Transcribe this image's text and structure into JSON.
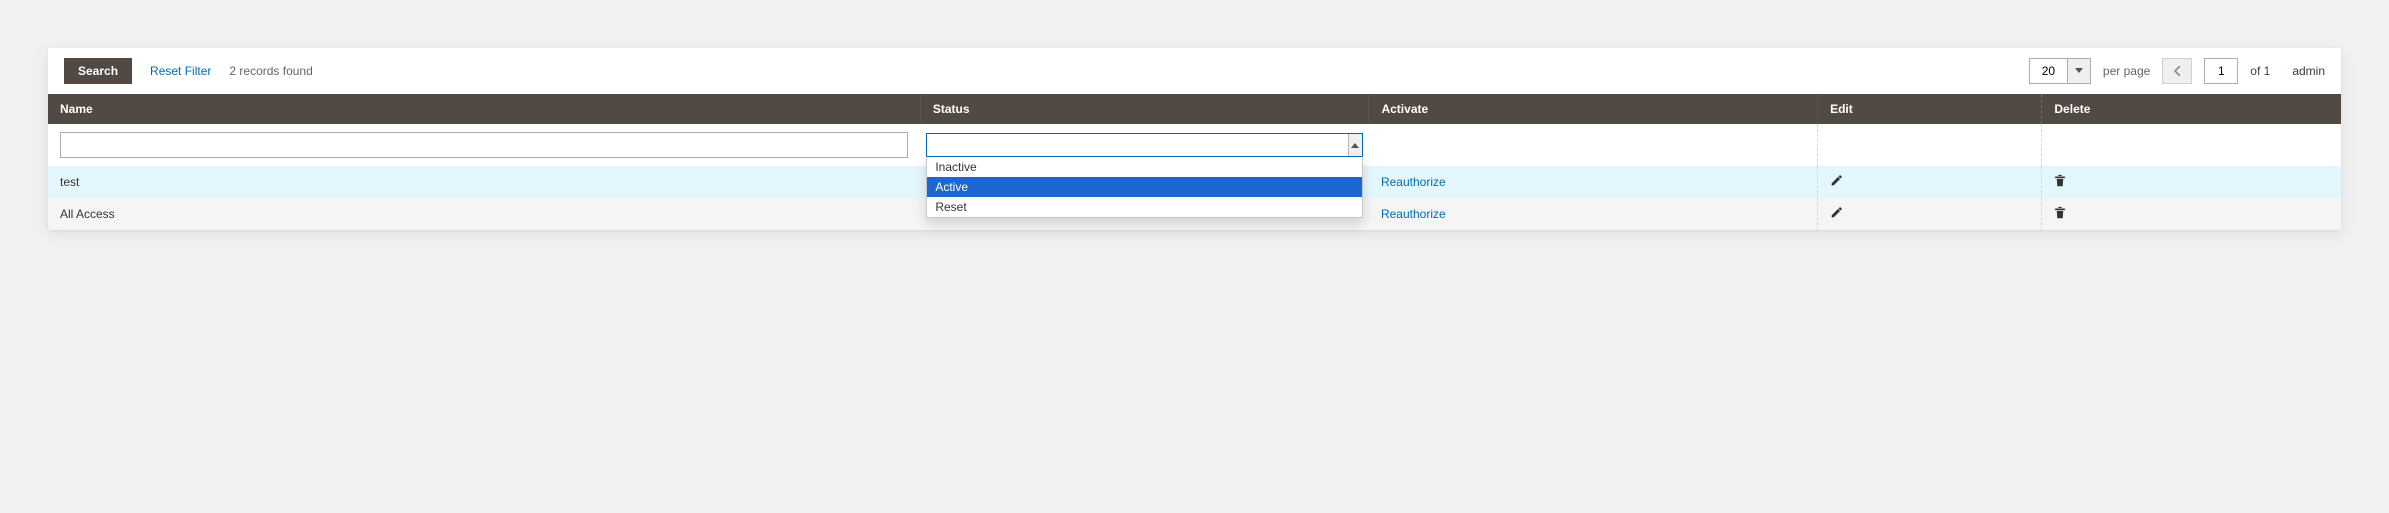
{
  "toolbar": {
    "search_label": "Search",
    "reset_label": "Reset Filter",
    "records_found": "2 records found",
    "per_page_value": "20",
    "per_page_label": "per page",
    "page_value": "1",
    "of_label": "of 1",
    "account_label": "admin"
  },
  "columns": {
    "name": "Name",
    "status": "Status",
    "activate": "Activate",
    "edit": "Edit",
    "delete": "Delete"
  },
  "status_filter": {
    "selected": "",
    "options": [
      "Inactive",
      "Active",
      "Reset"
    ],
    "highlighted": "Active"
  },
  "rows": [
    {
      "name": "test",
      "activate": "Reauthorize"
    },
    {
      "name": "All Access",
      "activate": "Reauthorize"
    }
  ],
  "icons": {
    "pencil": "pencil-icon",
    "trash": "trash-icon",
    "chevron_left": "chevron-left-icon",
    "caret_down": "caret-down-icon",
    "caret_up": "caret-up-icon"
  }
}
